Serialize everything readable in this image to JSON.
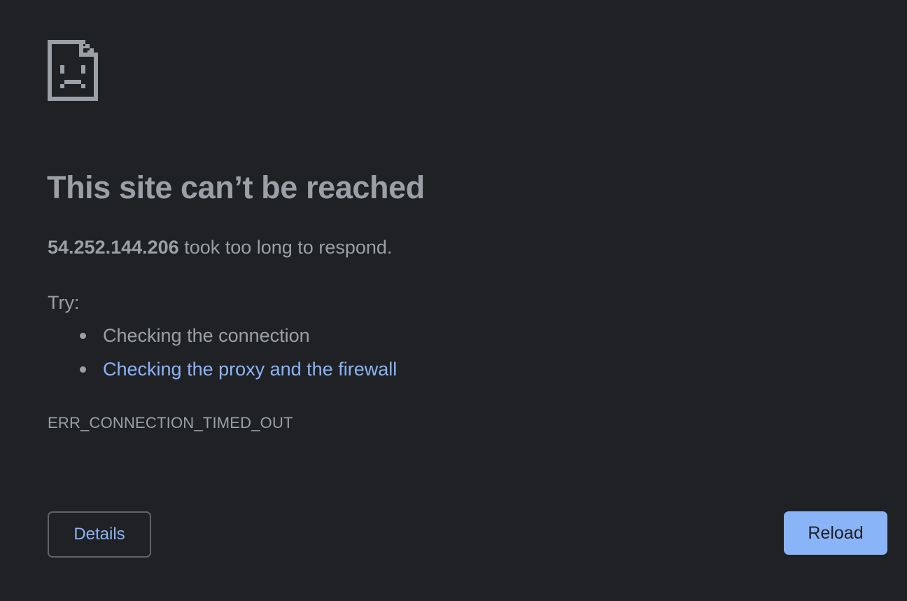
{
  "icon": {
    "name": "sad-page-icon",
    "color": "#9aa0a6"
  },
  "error": {
    "heading": "This site can’t be reached",
    "host": "54.252.144.206",
    "summary_suffix": " took too long to respond.",
    "try_label": "Try:",
    "suggestions": [
      {
        "text": "Checking the connection",
        "is_link": false
      },
      {
        "text": "Checking the proxy and the firewall",
        "is_link": true
      }
    ],
    "code": "ERR_CONNECTION_TIMED_OUT"
  },
  "buttons": {
    "details_label": "Details",
    "reload_label": "Reload"
  },
  "colors": {
    "background": "#202124",
    "text": "#9aa0a6",
    "link": "#8ab4f8",
    "primary_button": "#8ab4f8",
    "primary_button_text": "#202124",
    "secondary_border": "#5f6368"
  }
}
